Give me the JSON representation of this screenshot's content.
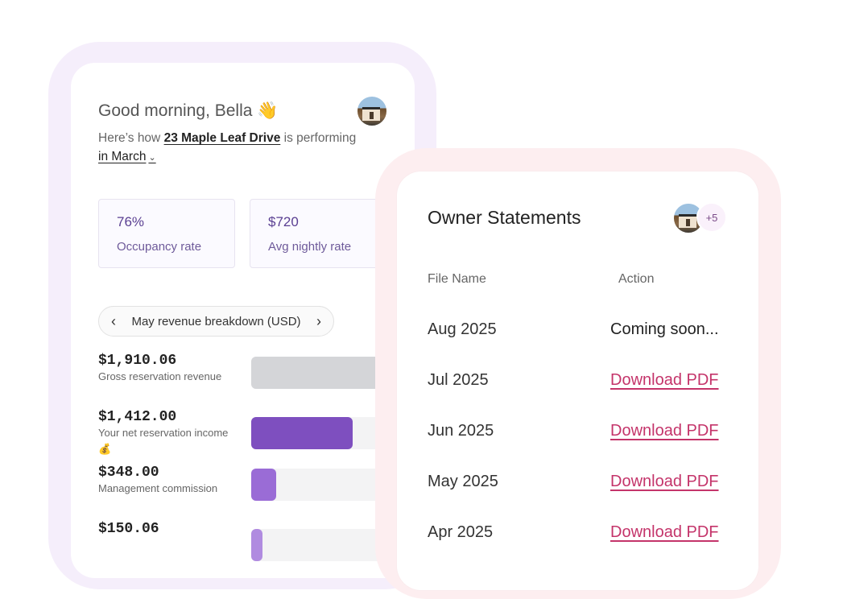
{
  "dashboard": {
    "greeting": "Good morning, Bella 👋",
    "intro_text": "Here’s how",
    "property": "23 Maple Leaf Drive",
    "performing_text": "is performing",
    "month": "in March",
    "stats": [
      {
        "value": "76%",
        "label": "Occupancy rate"
      },
      {
        "value": "$720",
        "label": "Avg nightly rate"
      }
    ],
    "breakdown_label": "May revenue breakdown (USD)",
    "revenue": [
      {
        "amount": "$1,910.06",
        "label": "Gross reservation revenue",
        "fill_fraction": 1.0,
        "color": "#d4d5d8"
      },
      {
        "amount": "$1,412.00",
        "label": "Your net reservation income 💰",
        "fill_fraction": 0.74,
        "color": "#7e4fbf"
      },
      {
        "amount": "$348.00",
        "label": "Management commission",
        "fill_fraction": 0.18,
        "color": "#9a6cd6"
      },
      {
        "amount": "$150.06",
        "label": "",
        "fill_fraction": 0.08,
        "color": "#b08be0"
      }
    ]
  },
  "statements": {
    "title": "Owner Statements",
    "extra_owners": "+5",
    "col_file": "File Name",
    "col_action": "Action",
    "rows": [
      {
        "name": "Aug 2025",
        "action": "Coming soon..."
      },
      {
        "name": "Jul 2025",
        "action": "Download PDF"
      },
      {
        "name": "Jun 2025",
        "action": "Download PDF"
      },
      {
        "name": "May 2025",
        "action": "Download PDF"
      },
      {
        "name": "Apr 2025",
        "action": "Download PDF"
      }
    ]
  },
  "colors": {
    "accent_link": "#c4346a",
    "stat_text": "#5a3f92"
  }
}
